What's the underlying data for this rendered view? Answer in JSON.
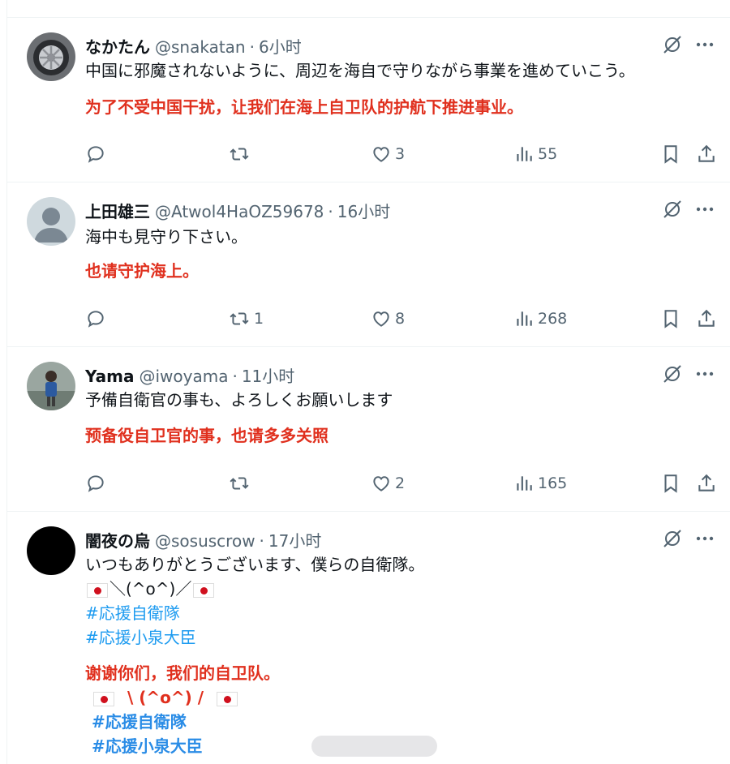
{
  "colors": {
    "accent": "#1d9bf0",
    "translation": "#e0301e",
    "muted": "#536471"
  },
  "posts": [
    {
      "name": "なかたん",
      "handle": "@snakatan",
      "sep": "·",
      "time": "6小时",
      "text": "中国に邪魔されないように、周辺を海自で守りながら事業を進めていこう。",
      "translation": "为了不受中国干扰，让我们在海上自卫队的护航下推进事业。",
      "reply_count": "",
      "repost_count": "",
      "like_count": "3",
      "view_count": "55"
    },
    {
      "name": "上田雄三",
      "handle": "@Atwol4HaOZ59678",
      "sep": "·",
      "time": "16小时",
      "text": "海中も見守り下さい。",
      "translation": "也请守护海上。",
      "reply_count": "",
      "repost_count": "1",
      "like_count": "8",
      "view_count": "268"
    },
    {
      "name": "Yama",
      "handle": "@iwoyama",
      "sep": "·",
      "time": "11小时",
      "text": "予備自衛官の事も、よろしくお願いします",
      "translation": "预备役自卫官的事，也请多多关照",
      "reply_count": "",
      "repost_count": "",
      "like_count": "2",
      "view_count": "165"
    },
    {
      "name": "闇夜の烏",
      "handle": "@sosuscrow",
      "sep": "·",
      "time": "17小时",
      "text": "いつもありがとうございます、僕らの自衛隊。",
      "kaomoji": "＼(^o^)／",
      "hashtags": [
        "#応援自衛隊",
        "#応援小泉大臣"
      ],
      "translation": "谢谢你们，我们的自卫队。",
      "translation_kaomoji": "\\ (^o^) /",
      "translation_hashtags": [
        "#応援自衛隊",
        "#応援小泉大臣"
      ]
    }
  ],
  "icons": {
    "grok": "grok-icon",
    "more": "more-icon",
    "reply": "reply-icon",
    "repost": "repost-icon",
    "like": "heart-icon",
    "views": "views-icon",
    "bookmark": "bookmark-icon",
    "share": "share-icon"
  }
}
